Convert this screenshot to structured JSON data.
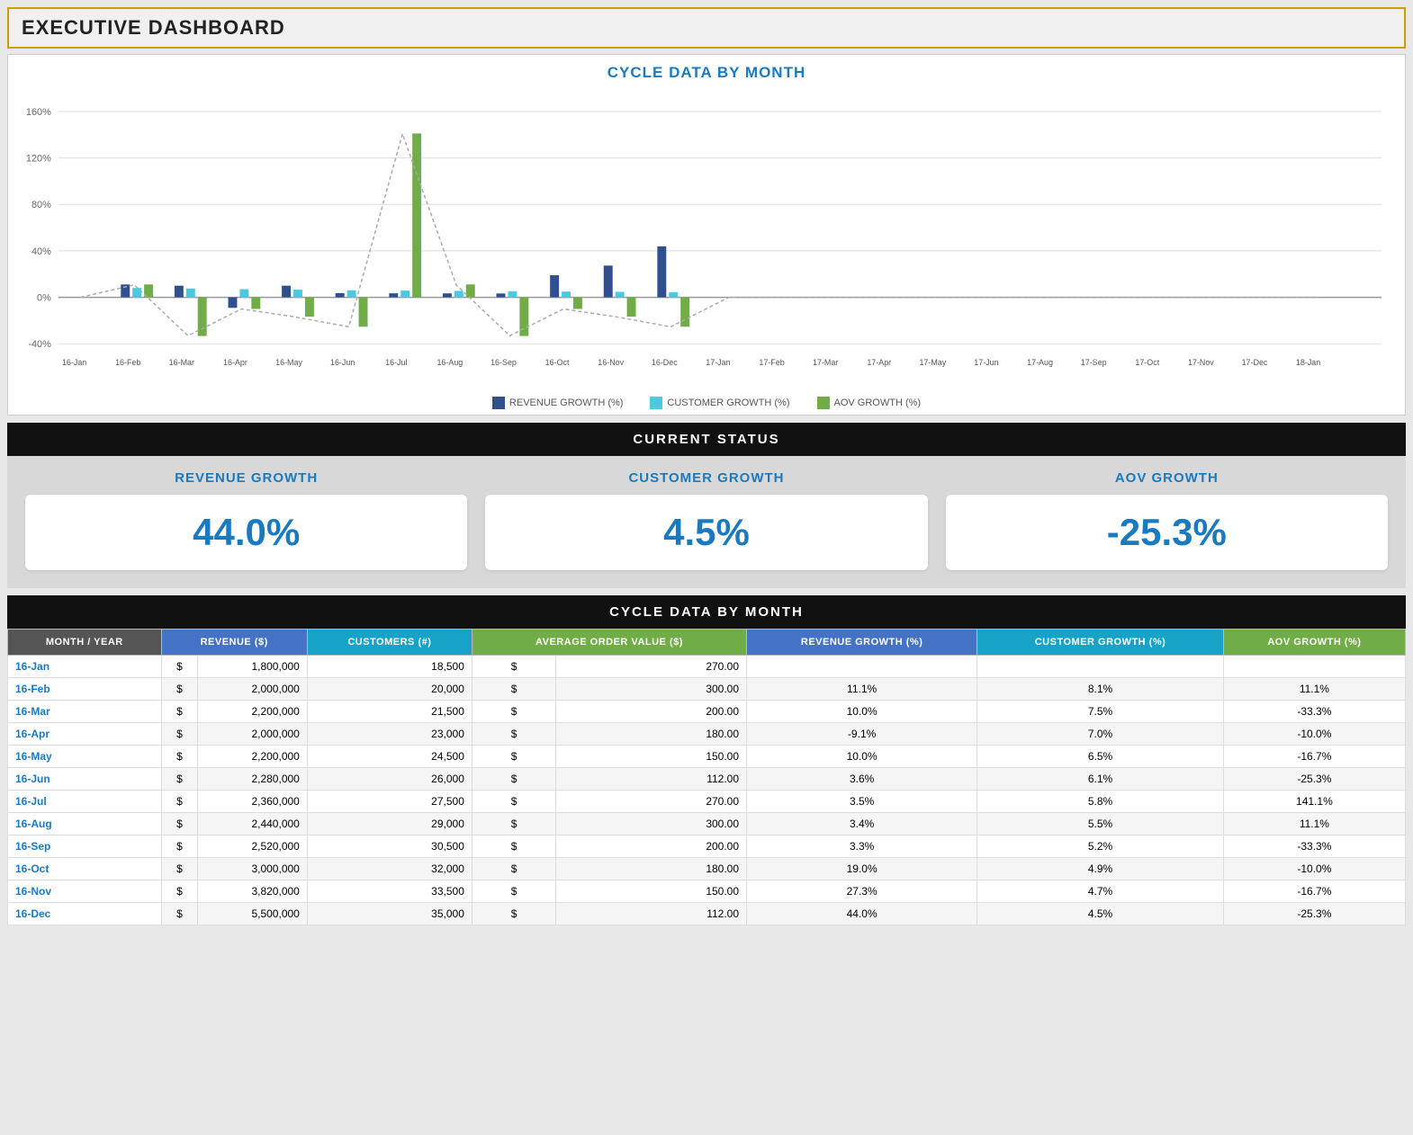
{
  "header": {
    "title": "EXECUTIVE DASHBOARD"
  },
  "chart": {
    "title": "CYCLE DATA BY MONTH",
    "legend": [
      {
        "label": "REVENUE GROWTH (%)",
        "color": "#2f4f8f"
      },
      {
        "label": "CUSTOMER GROWTH (%)",
        "color": "#4cc9e0"
      },
      {
        "label": "AOV GROWTH (%)",
        "color": "#70ad47"
      }
    ],
    "xLabels": [
      "16-Jan",
      "16-Feb",
      "16-Mar",
      "16-Apr",
      "16-May",
      "16-Jun",
      "16-Jul",
      "16-Aug",
      "16-Sep",
      "16-Oct",
      "16-Nov",
      "16-Dec",
      "17-Jan",
      "17-Feb",
      "17-Mar",
      "17-Apr",
      "17-May",
      "17-Jun",
      "17-Aug",
      "17-Sep",
      "17-Oct",
      "17-Nov",
      "17-Dec",
      "18-Jan"
    ],
    "revenueGrowth": [
      0,
      11.1,
      10.0,
      -9.1,
      10.0,
      3.6,
      3.5,
      3.4,
      3.3,
      19.0,
      27.3,
      44.0,
      0,
      0,
      0,
      0,
      0,
      0,
      0,
      0,
      0,
      0,
      0,
      0
    ],
    "customerGrowth": [
      0,
      8.1,
      7.5,
      7.0,
      6.5,
      6.1,
      5.8,
      5.5,
      5.2,
      4.9,
      4.7,
      4.5,
      0,
      0,
      0,
      0,
      0,
      0,
      0,
      0,
      0,
      0,
      0,
      0
    ],
    "aovGrowth": [
      0,
      11.1,
      -33.3,
      -10.0,
      -16.7,
      -25.3,
      141.1,
      11.1,
      -33.3,
      -10.0,
      -16.7,
      -25.3,
      0,
      0,
      0,
      0,
      0,
      0,
      0,
      0,
      0,
      0,
      0,
      0
    ]
  },
  "currentStatus": {
    "header": "CURRENT STATUS",
    "cards": [
      {
        "label": "REVENUE GROWTH",
        "value": "44.0%"
      },
      {
        "label": "CUSTOMER GROWTH",
        "value": "4.5%"
      },
      {
        "label": "AOV GROWTH",
        "value": "-25.3%"
      }
    ]
  },
  "table": {
    "title": "CYCLE DATA BY MONTH",
    "columns": [
      "MONTH / YEAR",
      "REVENUE  ($)",
      "CUSTOMERS  (#)",
      "AVERAGE ORDER VALUE ($)",
      "REVENUE GROWTH  (%)",
      "CUSTOMER GROWTH  (%)",
      "AOV GROWTH  (%)"
    ],
    "rows": [
      [
        "16-Jan",
        "$",
        "1,800,000",
        "18,500",
        "$",
        "270.00",
        "",
        "",
        ""
      ],
      [
        "16-Feb",
        "$",
        "2,000,000",
        "20,000",
        "$",
        "300.00",
        "11.1%",
        "8.1%",
        "11.1%"
      ],
      [
        "16-Mar",
        "$",
        "2,200,000",
        "21,500",
        "$",
        "200.00",
        "10.0%",
        "7.5%",
        "-33.3%"
      ],
      [
        "16-Apr",
        "$",
        "2,000,000",
        "23,000",
        "$",
        "180.00",
        "-9.1%",
        "7.0%",
        "-10.0%"
      ],
      [
        "16-May",
        "$",
        "2,200,000",
        "24,500",
        "$",
        "150.00",
        "10.0%",
        "6.5%",
        "-16.7%"
      ],
      [
        "16-Jun",
        "$",
        "2,280,000",
        "26,000",
        "$",
        "112.00",
        "3.6%",
        "6.1%",
        "-25.3%"
      ],
      [
        "16-Jul",
        "$",
        "2,360,000",
        "27,500",
        "$",
        "270.00",
        "3.5%",
        "5.8%",
        "141.1%"
      ],
      [
        "16-Aug",
        "$",
        "2,440,000",
        "29,000",
        "$",
        "300.00",
        "3.4%",
        "5.5%",
        "11.1%"
      ],
      [
        "16-Sep",
        "$",
        "2,520,000",
        "30,500",
        "$",
        "200.00",
        "3.3%",
        "5.2%",
        "-33.3%"
      ],
      [
        "16-Oct",
        "$",
        "3,000,000",
        "32,000",
        "$",
        "180.00",
        "19.0%",
        "4.9%",
        "-10.0%"
      ],
      [
        "16-Nov",
        "$",
        "3,820,000",
        "33,500",
        "$",
        "150.00",
        "27.3%",
        "4.7%",
        "-16.7%"
      ],
      [
        "16-Dec",
        "$",
        "5,500,000",
        "35,000",
        "$",
        "112.00",
        "44.0%",
        "4.5%",
        "-25.3%"
      ]
    ]
  }
}
